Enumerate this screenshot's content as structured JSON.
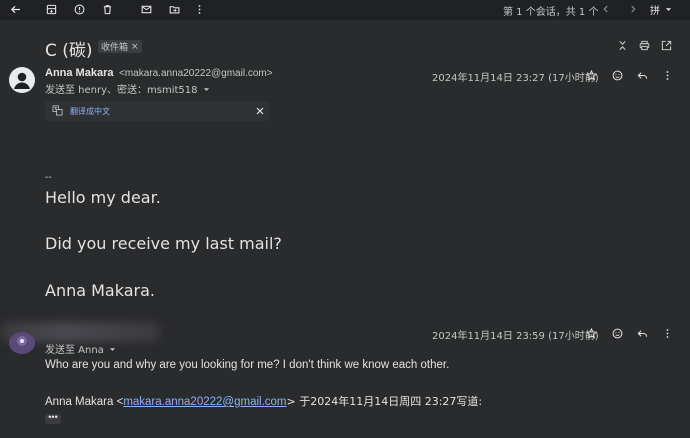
{
  "toolbar": {
    "icons": [
      "back-icon",
      "archive-icon",
      "report-spam-icon",
      "delete-icon",
      "mark-unread-icon",
      "move-to-icon",
      "more-icon"
    ],
    "count_text": "第 1 个会话，共 1 个",
    "input_tools": "拼"
  },
  "thread": {
    "title": "C (碳)",
    "label": "收件箱",
    "label_close": "×"
  },
  "message1": {
    "sender_name": "Anna Makara",
    "sender_email": "<makara.anna20222@gmail.com>",
    "recipients": "发送至 henry、密送：msmit518",
    "date": "2024年11月14日 23:27 (17小时前)",
    "translate_label": "翻译成中文",
    "signature_dash": "--",
    "body": [
      "Hello my dear.",
      "Did you receive my last mail?",
      "Anna Makara."
    ]
  },
  "message2": {
    "recipients": "发送至 Anna",
    "date": "2024年11月14日 23:59 (17小时前)",
    "body": "Who are you and why are you looking for me? I don't think we know each other.",
    "quote_prefix": "Anna Makara <",
    "quote_email": "makara.anna20222@gmail.com",
    "quote_suffix": "> 于2024年11月14日周四 23:27写道:",
    "more_label": "•••"
  }
}
